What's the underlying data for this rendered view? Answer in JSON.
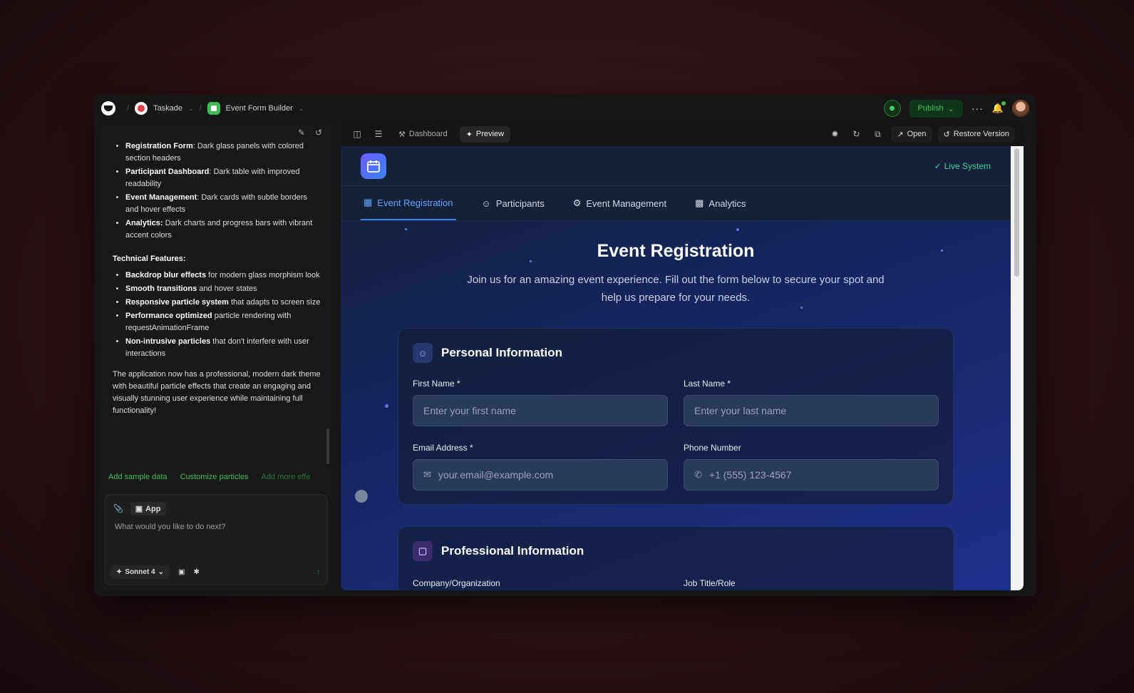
{
  "topbar": {
    "workspace": "Taskade",
    "project": "Event Form Builder",
    "publish_label": "Publish"
  },
  "left_panel": {
    "bullets1": [
      {
        "bold": "Registration Form",
        "text": ": Dark glass panels with colored section headers"
      },
      {
        "bold": "Participant Dashboard",
        "text": ": Dark table with improved readability"
      },
      {
        "bold": "Event Management",
        "text": ": Dark cards with subtle borders and hover effects"
      },
      {
        "bold": "Analytics:",
        "text": " Dark charts and progress bars with vibrant accent colors"
      }
    ],
    "tech_heading": "Technical Features:",
    "bullets2": [
      {
        "bold": "Backdrop blur effects",
        "text": " for modern glass morphism look"
      },
      {
        "bold": "Smooth transitions",
        "text": " and hover states"
      },
      {
        "bold": "Responsive particle system",
        "text": " that adapts to screen size"
      },
      {
        "bold": "Performance optimized",
        "text": " particle rendering with requestAnimationFrame"
      },
      {
        "bold": "Non-intrusive particles",
        "text": " that don't interfere with user interactions"
      }
    ],
    "summary": "The application now has a professional, modern dark theme with beautiful particle effects that create an engaging and visually stunning user experience while maintaining full functionality!",
    "suggestions": [
      "Add sample data",
      "Customize particles",
      "Add more effe"
    ],
    "composer": {
      "chip": "App",
      "placeholder": "What would you like to do next?",
      "model": "Sonnet 4"
    }
  },
  "right_toolbar": {
    "dashboard": "Dashboard",
    "preview": "Preview",
    "open": "Open",
    "restore": "Restore Version"
  },
  "preview": {
    "live_status": "Live System",
    "tabs": [
      "Event Registration",
      "Participants",
      "Event Management",
      "Analytics"
    ],
    "title": "Event Registration",
    "subtitle": "Join us for an amazing event experience. Fill out the form below to secure your spot and help us prepare for your needs.",
    "section1": {
      "title": "Personal Information",
      "first_name_label": "First Name *",
      "first_name_placeholder": "Enter your first name",
      "last_name_label": "Last Name *",
      "last_name_placeholder": "Enter your last name",
      "email_label": "Email Address *",
      "email_placeholder": "your.email@example.com",
      "phone_label": "Phone Number",
      "phone_placeholder": "+1 (555) 123-4567"
    },
    "section2": {
      "title": "Professional Information",
      "company_label": "Company/Organization",
      "job_label": "Job Title/Role"
    }
  },
  "colors": {
    "accent_green": "#3fbf5c",
    "accent_blue": "#60a5fa",
    "live_green": "#34d399"
  }
}
